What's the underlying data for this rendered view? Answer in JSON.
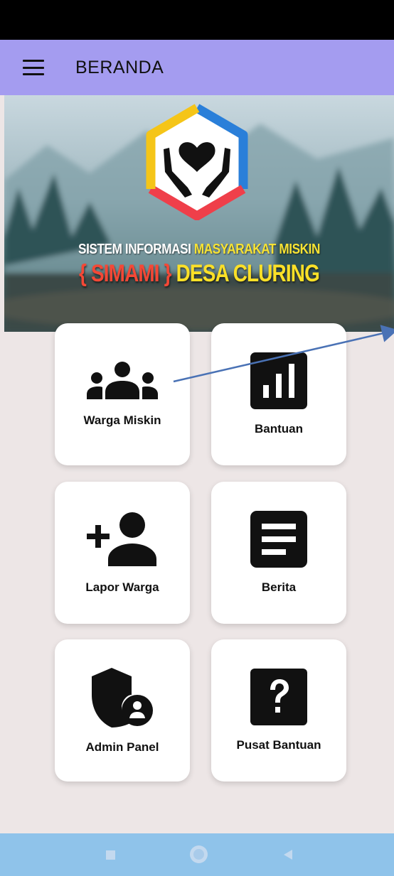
{
  "app_bar": {
    "title": "BERANDA",
    "menu_icon": "hamburger-menu-icon",
    "background": "#a49cf0"
  },
  "banner": {
    "line1_white": "SISTEM INFORMASI",
    "line1_yellow": " MASYARAKAT MISKIN",
    "line2_red": "{ SIMAMI }",
    "line2_yellow": " DESA CLURING",
    "logo_icon": "hands-heart-logo-icon"
  },
  "menu": {
    "warga_miskin": {
      "label": "Warga Miskin",
      "icon": "group-people-icon"
    },
    "bantuan": {
      "label": "Bantuan",
      "icon": "bar-chart-icon"
    },
    "lapor_warga": {
      "label": "Lapor Warga",
      "icon": "person-add-icon"
    },
    "berita": {
      "label": "Berita",
      "icon": "article-icon"
    },
    "admin_panel": {
      "label": "Admin Panel",
      "icon": "admin-shield-icon"
    },
    "pusat_bantuan": {
      "label": "Pusat Bantuan",
      "icon": "help-question-icon"
    }
  },
  "nav_bar": {
    "background": "#8fc3ea",
    "recents_icon": "square-recents-icon",
    "home_icon": "circle-home-icon",
    "back_icon": "triangle-back-icon"
  },
  "colors": {
    "page_background": "#ede6e6",
    "card_background": "#ffffff",
    "annotation_arrow": "#4a72b5"
  }
}
